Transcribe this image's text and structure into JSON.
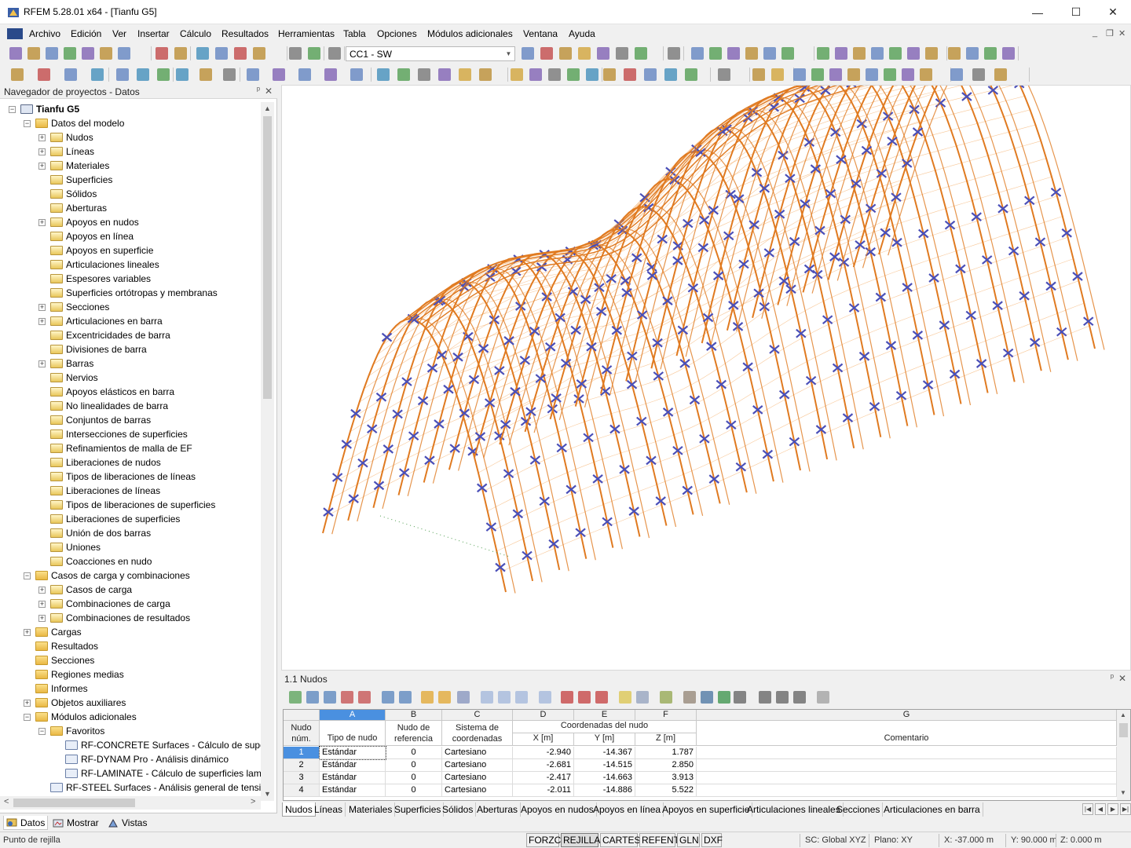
{
  "window": {
    "title": "RFEM 5.28.01 x64 - [Tianfu G5]",
    "min_glyph": "—",
    "max_glyph": "☐",
    "close_glyph": "✕"
  },
  "menu": {
    "items": [
      "Archivo",
      "Edición",
      "Ver",
      "Insertar",
      "Cálculo",
      "Resultados",
      "Herramientas",
      "Tabla",
      "Opciones",
      "Módulos adicionales",
      "Ventana",
      "Ayuda"
    ],
    "mdi_min": "_",
    "mdi_restore": "❐",
    "mdi_close": "✕"
  },
  "toolbar": {
    "load_case_combo": "CC1 - SW",
    "combo_arrow": "▼"
  },
  "navigator": {
    "title": "Navegador de proyectos - Datos",
    "pin": "ᵖ",
    "close": "✕",
    "tree": [
      {
        "label": "Tianfu G5",
        "level": 0,
        "exp": "−",
        "icon": "root",
        "bold": true
      },
      {
        "label": "Datos del modelo",
        "level": 1,
        "exp": "−",
        "icon": "folder"
      },
      {
        "label": "Nudos",
        "level": 2,
        "exp": "+",
        "icon": "item"
      },
      {
        "label": "Líneas",
        "level": 2,
        "exp": "+",
        "icon": "item"
      },
      {
        "label": "Materiales",
        "level": 2,
        "exp": "+",
        "icon": "item"
      },
      {
        "label": "Superficies",
        "level": 2,
        "exp": "",
        "icon": "item"
      },
      {
        "label": "Sólidos",
        "level": 2,
        "exp": "",
        "icon": "item"
      },
      {
        "label": "Aberturas",
        "level": 2,
        "exp": "",
        "icon": "item"
      },
      {
        "label": "Apoyos en nudos",
        "level": 2,
        "exp": "+",
        "icon": "item"
      },
      {
        "label": "Apoyos en línea",
        "level": 2,
        "exp": "",
        "icon": "item"
      },
      {
        "label": "Apoyos en superficie",
        "level": 2,
        "exp": "",
        "icon": "item"
      },
      {
        "label": "Articulaciones lineales",
        "level": 2,
        "exp": "",
        "icon": "item"
      },
      {
        "label": "Espesores variables",
        "level": 2,
        "exp": "",
        "icon": "item"
      },
      {
        "label": "Superficies ortótropas y membranas",
        "level": 2,
        "exp": "",
        "icon": "item"
      },
      {
        "label": "Secciones",
        "level": 2,
        "exp": "+",
        "icon": "item"
      },
      {
        "label": "Articulaciones en barra",
        "level": 2,
        "exp": "+",
        "icon": "item"
      },
      {
        "label": "Excentricidades de barra",
        "level": 2,
        "exp": "",
        "icon": "item"
      },
      {
        "label": "Divisiones de barra",
        "level": 2,
        "exp": "",
        "icon": "item"
      },
      {
        "label": "Barras",
        "level": 2,
        "exp": "+",
        "icon": "item"
      },
      {
        "label": "Nervios",
        "level": 2,
        "exp": "",
        "icon": "item"
      },
      {
        "label": "Apoyos elásticos en barra",
        "level": 2,
        "exp": "",
        "icon": "item"
      },
      {
        "label": "No linealidades de barra",
        "level": 2,
        "exp": "",
        "icon": "item"
      },
      {
        "label": "Conjuntos de barras",
        "level": 2,
        "exp": "",
        "icon": "item"
      },
      {
        "label": "Intersecciones de superficies",
        "level": 2,
        "exp": "",
        "icon": "item"
      },
      {
        "label": "Refinamientos de malla de EF",
        "level": 2,
        "exp": "",
        "icon": "item"
      },
      {
        "label": "Liberaciones de nudos",
        "level": 2,
        "exp": "",
        "icon": "item"
      },
      {
        "label": "Tipos de liberaciones de líneas",
        "level": 2,
        "exp": "",
        "icon": "item"
      },
      {
        "label": "Liberaciones de líneas",
        "level": 2,
        "exp": "",
        "icon": "item"
      },
      {
        "label": "Tipos de liberaciones de superficies",
        "level": 2,
        "exp": "",
        "icon": "item"
      },
      {
        "label": "Liberaciones de superficies",
        "level": 2,
        "exp": "",
        "icon": "item"
      },
      {
        "label": "Unión de dos barras",
        "level": 2,
        "exp": "",
        "icon": "item"
      },
      {
        "label": "Uniones",
        "level": 2,
        "exp": "",
        "icon": "item"
      },
      {
        "label": "Coacciones en nudo",
        "level": 2,
        "exp": "",
        "icon": "item"
      },
      {
        "label": "Casos de carga y combinaciones",
        "level": 1,
        "exp": "−",
        "icon": "folder"
      },
      {
        "label": "Casos de carga",
        "level": 2,
        "exp": "+",
        "icon": "item"
      },
      {
        "label": "Combinaciones de carga",
        "level": 2,
        "exp": "+",
        "icon": "item"
      },
      {
        "label": "Combinaciones de resultados",
        "level": 2,
        "exp": "+",
        "icon": "item"
      },
      {
        "label": "Cargas",
        "level": 1,
        "exp": "+",
        "icon": "folder"
      },
      {
        "label": "Resultados",
        "level": 1,
        "exp": "",
        "icon": "folder"
      },
      {
        "label": "Secciones",
        "level": 1,
        "exp": "",
        "icon": "folder"
      },
      {
        "label": "Regiones medias",
        "level": 1,
        "exp": "",
        "icon": "folder"
      },
      {
        "label": "Informes",
        "level": 1,
        "exp": "",
        "icon": "folder"
      },
      {
        "label": "Objetos auxiliares",
        "level": 1,
        "exp": "+",
        "icon": "folder"
      },
      {
        "label": "Módulos adicionales",
        "level": 1,
        "exp": "−",
        "icon": "folder"
      },
      {
        "label": "Favoritos",
        "level": 2,
        "exp": "−",
        "icon": "folder"
      },
      {
        "label": "RF-CONCRETE Surfaces - Cálculo de superf",
        "level": 3,
        "exp": "",
        "icon": "mod"
      },
      {
        "label": "RF-DYNAM Pro - Análisis dinámico",
        "level": 3,
        "exp": "",
        "icon": "mod"
      },
      {
        "label": "RF-LAMINATE - Cálculo de superficies lami",
        "level": 3,
        "exp": "",
        "icon": "mod"
      },
      {
        "label": "RF-STEEL Surfaces - Análisis general de tension",
        "level": 2,
        "exp": "",
        "icon": "mod"
      }
    ],
    "tabs": [
      "Datos",
      "Mostrar",
      "Vistas"
    ],
    "scroll_up": "▲",
    "scroll_down": "▼",
    "scroll_left": "<",
    "scroll_right": ">"
  },
  "table": {
    "title": "1.1 Nudos",
    "pin": "ᵖ",
    "close": "✕",
    "col_letters": [
      "A",
      "B",
      "C",
      "D",
      "E",
      "F",
      "G"
    ],
    "headers": {
      "nudo_1": "Nudo",
      "nudo_2": "núm.",
      "tipo": "Tipo de nudo",
      "ref_1": "Nudo de",
      "ref_2": "referencia",
      "sis_1": "Sistema de",
      "sis_2": "coordenadas",
      "coords": "Coordenadas del nudo",
      "x": "X [m]",
      "y": "Y [m]",
      "z": "Z [m]",
      "comentario": "Comentario"
    },
    "rows": [
      {
        "num": "1",
        "tipo": "Estándar",
        "ref": "0",
        "sistema": "Cartesiano",
        "x": "-2.940",
        "y": "-14.367",
        "z": "1.787",
        "comentario": ""
      },
      {
        "num": "2",
        "tipo": "Estándar",
        "ref": "0",
        "sistema": "Cartesiano",
        "x": "-2.681",
        "y": "-14.515",
        "z": "2.850",
        "comentario": ""
      },
      {
        "num": "3",
        "tipo": "Estándar",
        "ref": "0",
        "sistema": "Cartesiano",
        "x": "-2.417",
        "y": "-14.663",
        "z": "3.913",
        "comentario": ""
      },
      {
        "num": "4",
        "tipo": "Estándar",
        "ref": "0",
        "sistema": "Cartesiano",
        "x": "-2.011",
        "y": "-14.886",
        "z": "5.522",
        "comentario": ""
      }
    ],
    "tabs": [
      "Nudos",
      "Líneas",
      "Materiales",
      "Superficies",
      "Sólidos",
      "Aberturas",
      "Apoyos en nudos",
      "Apoyos en línea",
      "Apoyos en superficie",
      "Articulaciones lineales",
      "Secciones",
      "Articulaciones en barra"
    ],
    "nav_first": "|◀",
    "nav_prev": "◀",
    "nav_next": "▶",
    "nav_last": "▶|"
  },
  "statusbar": {
    "message": "Punto de rejilla",
    "toggles": [
      {
        "label": "FORZC",
        "on": false
      },
      {
        "label": "REJILLA",
        "on": true
      },
      {
        "label": "CARTES",
        "on": false
      },
      {
        "label": "REFENT",
        "on": false
      },
      {
        "label": "GLN",
        "on": false
      },
      {
        "label": "DXF",
        "on": false
      }
    ],
    "sc": "SC: Global XYZ",
    "plane": "Plano: XY",
    "x": "X:  -37.000 m",
    "y": "Y:  90.000 m",
    "z": "Z:  0.000 m"
  },
  "colors": {
    "arch": "#e07a20",
    "bracing": "#4a4fb8",
    "purlin": "#f29a45"
  }
}
